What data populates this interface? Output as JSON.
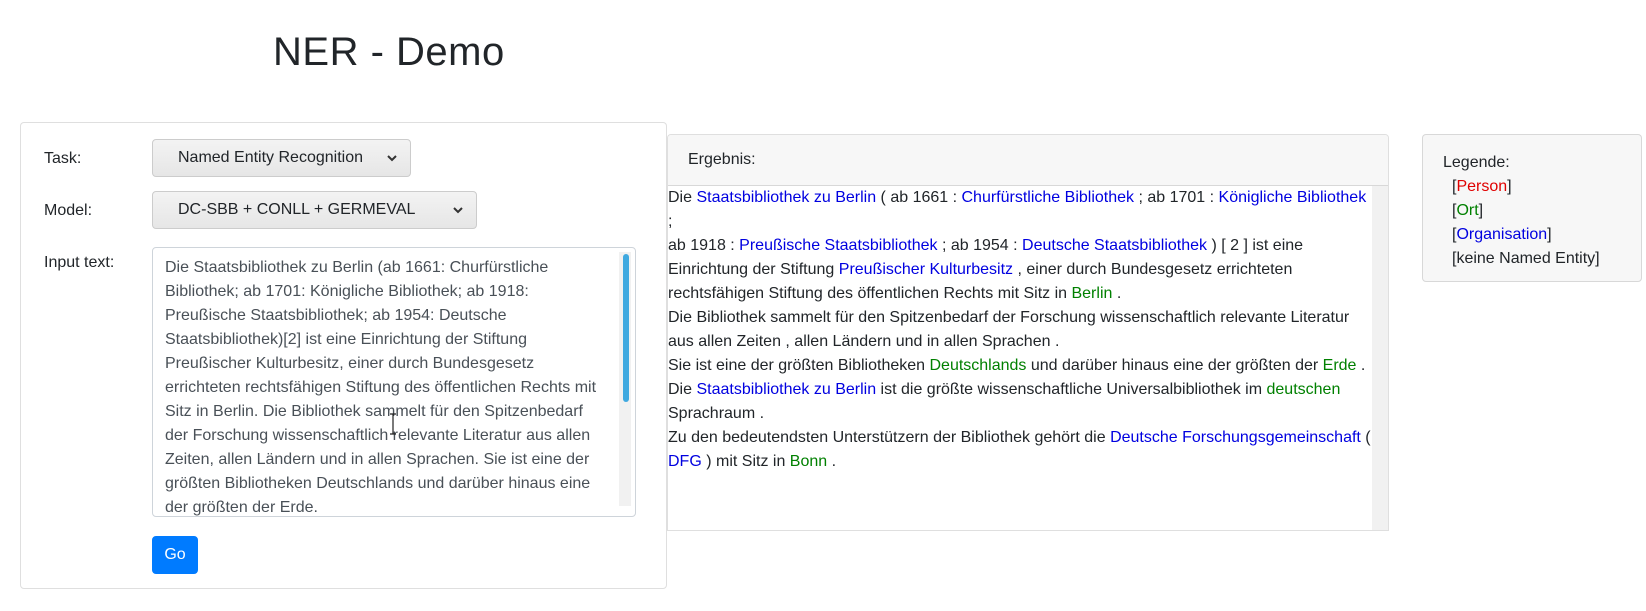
{
  "page": {
    "title": "NER - Demo"
  },
  "form": {
    "task_label": "Task:",
    "task_value": "Named Entity Recognition",
    "model_label": "Model:",
    "model_value": "DC-SBB + CONLL + GERMEVAL",
    "input_label": "Input text:",
    "input_text": "Die Staatsbibliothek zu Berlin (ab 1661: Churfürstliche Bibliothek; ab 1701: Königliche Bibliothek; ab 1918: Preußische Staatsbibliothek; ab 1954: Deutsche Staatsbibliothek)[2] ist eine Einrichtung der Stiftung Preußischer Kulturbesitz, einer durch Bundesgesetz errichteten rechtsfähigen Stiftung des öffentlichen Rechts mit Sitz in Berlin. Die Bibliothek sammelt für den Spitzenbedarf der Forschung wissenschaftlich relevante Literatur aus allen Zeiten, allen Ländern und in allen Sprachen. Sie ist eine der größten Bibliotheken Deutschlands und darüber hinaus eine der größten der Erde.",
    "go_label": "Go"
  },
  "result": {
    "header": "Ergebnis:",
    "lines": [
      [
        [
          "",
          "Die "
        ],
        [
          "org",
          "Staatsbibliothek zu Berlin"
        ],
        [
          "",
          " ( ab 1661 : "
        ],
        [
          "org",
          "Churfürstliche Bibliothek"
        ],
        [
          "",
          " ; ab 1701 : "
        ],
        [
          "org",
          "Königliche Bibliothek"
        ],
        [
          "",
          " ;"
        ]
      ],
      [
        [
          "",
          "ab 1918 : "
        ],
        [
          "org",
          "Preußische Staatsbibliothek"
        ],
        [
          "",
          " ; ab 1954 : "
        ],
        [
          "org",
          "Deutsche Staatsbibliothek"
        ],
        [
          "",
          " ) [ 2 ] ist eine"
        ]
      ],
      [
        [
          "",
          "Einrichtung der Stiftung "
        ],
        [
          "org",
          "Preußischer Kulturbesitz"
        ],
        [
          "",
          " , einer durch Bundesgesetz errichteten"
        ]
      ],
      [
        [
          "",
          "rechtsfähigen Stiftung des öffentlichen Rechts mit Sitz in "
        ],
        [
          "loc",
          "Berlin"
        ],
        [
          "",
          " ."
        ]
      ],
      [
        [
          "",
          "Die Bibliothek sammelt für den Spitzenbedarf der Forschung wissenschaftlich relevante Literatur"
        ]
      ],
      [
        [
          "",
          "aus allen Zeiten , allen Ländern und in allen Sprachen ."
        ]
      ],
      [
        [
          "",
          "Sie ist eine der größten Bibliotheken "
        ],
        [
          "loc",
          "Deutschlands"
        ],
        [
          "",
          " und darüber hinaus eine der größten der "
        ],
        [
          "loc",
          "Erde"
        ],
        [
          "",
          " ."
        ]
      ],
      [
        [
          "",
          "Die "
        ],
        [
          "org",
          "Staatsbibliothek zu Berlin"
        ],
        [
          "",
          " ist die größte wissenschaftliche Universalbibliothek im "
        ],
        [
          "loc",
          "deutschen"
        ]
      ],
      [
        [
          "",
          "Sprachraum ."
        ]
      ],
      [
        [
          "",
          "Zu den bedeutendsten Unterstützern der Bibliothek gehört die "
        ],
        [
          "org",
          "Deutsche Forschungsgemeinschaft"
        ],
        [
          "",
          " ("
        ]
      ],
      [
        [
          "org",
          "DFG"
        ],
        [
          "",
          " ) mit Sitz in "
        ],
        [
          "loc",
          "Bonn"
        ],
        [
          "",
          " ."
        ]
      ]
    ]
  },
  "legend": {
    "title": "Legende:",
    "person": "Person",
    "location": "Ort",
    "organisation": "Organisation",
    "none": "[keine Named Entity]"
  },
  "colors": {
    "person": "#e00000",
    "location": "#008000",
    "organisation": "#0000e0",
    "button": "#007bff",
    "scrollbar_thumb": "#3fa9e0"
  },
  "icons": {
    "select_arrow": "chevron-down-icon",
    "mouse_cursor": "text-cursor-icon"
  }
}
